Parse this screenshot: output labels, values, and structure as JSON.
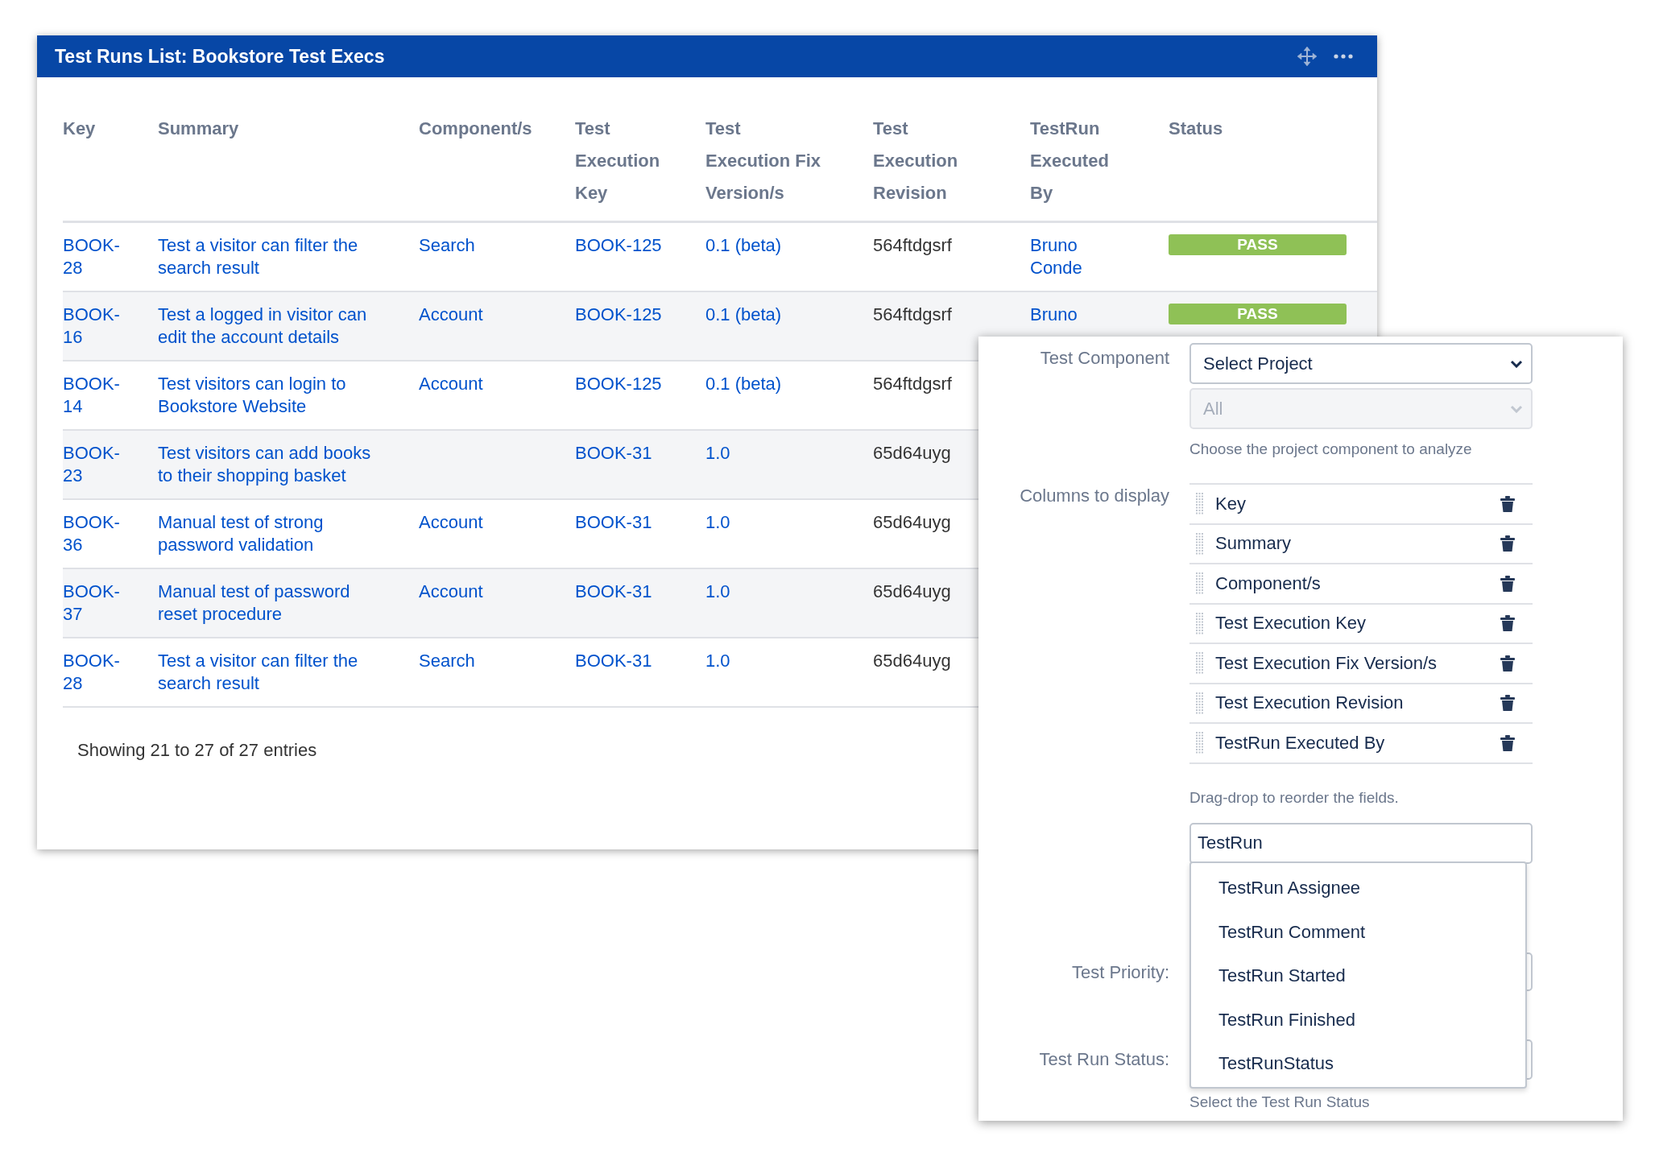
{
  "window": {
    "title": "Test Runs List: Bookstore Test Execs"
  },
  "table": {
    "columns": [
      "Key",
      "Summary",
      "Component/s",
      "Test Execution Key",
      "Test Execution Fix Version/s",
      "Test Execution Revision",
      "TestRun Executed By",
      "Status"
    ],
    "rows": [
      {
        "key": "BOOK-28",
        "summary": "Test a visitor can filter the search result",
        "components": "Search",
        "execution_key": "BOOK-125",
        "fix_versions": "0.1 (beta)",
        "revision": "564ftdgsrf",
        "executed_by": "Bruno Conde",
        "status": {
          "label": "PASS",
          "kind": "pass"
        }
      },
      {
        "key": "BOOK-16",
        "summary": "Test a logged in visitor can edit the account details",
        "components": "Account",
        "execution_key": "BOOK-125",
        "fix_versions": "0.1 (beta)",
        "revision": "564ftdgsrf",
        "executed_by": "Bruno",
        "status": {
          "label": "PASS",
          "kind": "pass"
        }
      },
      {
        "key": "BOOK-14",
        "summary": "Test visitors can login to Bookstore Website",
        "components": "Account",
        "execution_key": "BOOK-125",
        "fix_versions": "0.1 (beta)",
        "revision": "564ftdgsrf"
      },
      {
        "key": "BOOK-23",
        "summary": "Test visitors can add books to their shopping basket",
        "execution_key": "BOOK-31",
        "fix_versions": "1.0",
        "revision": "65d64uyg"
      },
      {
        "key": "BOOK-36",
        "summary": "Manual test of strong password validation",
        "components": "Account",
        "execution_key": "BOOK-31",
        "fix_versions": "1.0",
        "revision": "65d64uyg"
      },
      {
        "key": "BOOK-37",
        "summary": "Manual test of password reset procedure",
        "components": "Account",
        "execution_key": "BOOK-31",
        "fix_versions": "1.0",
        "revision": "65d64uyg"
      },
      {
        "key": "BOOK-28",
        "summary": "Test a visitor can filter the search result",
        "components": "Search",
        "execution_key": "BOOK-31",
        "fix_versions": "1.0",
        "revision": "65d64uyg"
      }
    ]
  },
  "footer": "Showing 21 to 27 of 27 entries",
  "config": {
    "component": {
      "label": "Test Component",
      "project_select": "Select Project",
      "component_select": {
        "value": "All",
        "disabled": true
      },
      "help": "Choose the project component to analyze"
    },
    "columns": {
      "label": "Columns to display",
      "items": [
        "Key",
        "Summary",
        "Component/s",
        "Test Execution Key",
        "Test Execution Fix Version/s",
        "Test Execution Revision",
        "TestRun Executed By"
      ],
      "help": "Drag-drop to reorder the fields.",
      "search": {
        "value": "TestRun"
      },
      "suggestions": [
        "TestRun Assignee",
        "TestRun Comment",
        "TestRun Started",
        "TestRun Finished",
        "TestRunStatus"
      ]
    },
    "priority": {
      "label": "Test Priority:"
    },
    "run_status": {
      "label": "Test Run Status:",
      "help": "Select the Test Run Status"
    }
  }
}
